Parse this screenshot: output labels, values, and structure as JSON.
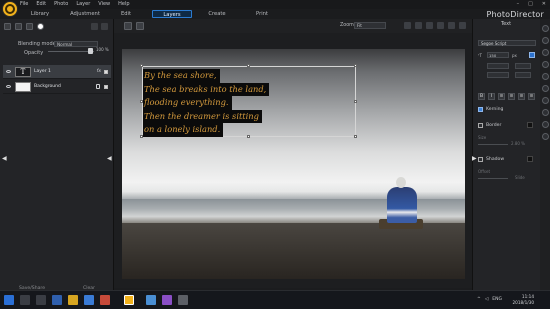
{
  "app": {
    "title": "PhotoDirector"
  },
  "menu": [
    "File",
    "Edit",
    "Photo",
    "Layer",
    "View",
    "Help"
  ],
  "modes": [
    {
      "label": "Library",
      "active": false
    },
    {
      "label": "Adjustment",
      "active": false
    },
    {
      "label": "Edit",
      "active": false
    },
    {
      "label": "Layers",
      "active": true
    },
    {
      "label": "Create",
      "active": false
    },
    {
      "label": "Print",
      "active": false
    }
  ],
  "layers_panel": {
    "blending_label": "Blending mode:",
    "blending_value": "Normal",
    "opacity_label": "Opacity",
    "opacity_value": "100 %",
    "layers": [
      {
        "name": "Layer 1",
        "thumb": "T",
        "selected": true
      },
      {
        "name": "Background",
        "thumb": "",
        "selected": false
      }
    ],
    "fx_label": "fx",
    "footer": {
      "save_share": "Save/Share",
      "clear": "Clear"
    }
  },
  "canvas": {
    "zoom_label": "Zoom:",
    "zoom_value": "Fit",
    "text_lines": [
      "By the sea shore,",
      "The sea breaks into the land,",
      "flooding everything.",
      "Then the dreamer is sitting",
      "on a lonely island."
    ],
    "text_color": "#d49a3d"
  },
  "text_panel": {
    "header": "Text",
    "font_value": "Segoe Script",
    "size_value": "150",
    "unit": "px",
    "accent_color": "#2d73d0",
    "kerning_label": "Kerning",
    "border_label": "Border",
    "size_label": "Size",
    "size_percent": "2.80 %",
    "shadow_label": "Shadow",
    "offset_label": "Offset",
    "offset_value": "Slide"
  },
  "taskbar": {
    "lang": "ENG",
    "time": "11:14",
    "date": "2018/1/30"
  }
}
